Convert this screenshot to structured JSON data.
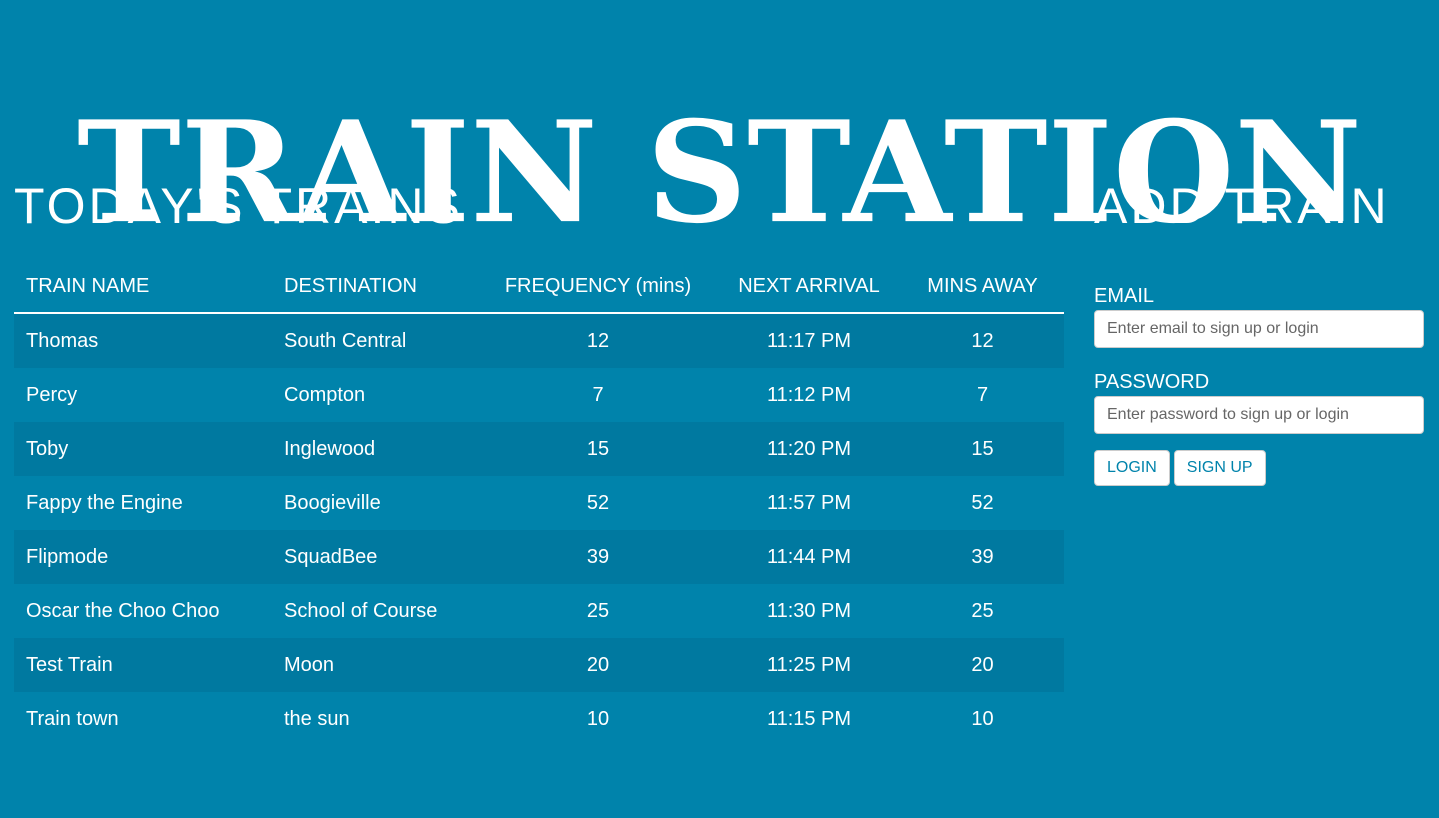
{
  "site": {
    "title": "TRAIN STATION"
  },
  "trains_section": {
    "title": "TODAY'S TRAINS",
    "columns": [
      "TRAIN NAME",
      "DESTINATION",
      "FREQUENCY (mins)",
      "NEXT ARRIVAL",
      "MINS AWAY"
    ],
    "rows": [
      {
        "name": "Thomas",
        "destination": "South Central",
        "frequency": "12",
        "next_arrival": "11:17 PM",
        "mins_away": "12"
      },
      {
        "name": "Percy",
        "destination": "Compton",
        "frequency": "7",
        "next_arrival": "11:12 PM",
        "mins_away": "7"
      },
      {
        "name": "Toby",
        "destination": "Inglewood",
        "frequency": "15",
        "next_arrival": "11:20 PM",
        "mins_away": "15"
      },
      {
        "name": "Fappy the Engine",
        "destination": "Boogieville",
        "frequency": "52",
        "next_arrival": "11:57 PM",
        "mins_away": "52"
      },
      {
        "name": "Flipmode",
        "destination": "SquadBee",
        "frequency": "39",
        "next_arrival": "11:44 PM",
        "mins_away": "39"
      },
      {
        "name": "Oscar the Choo Choo",
        "destination": "School of Course",
        "frequency": "25",
        "next_arrival": "11:30 PM",
        "mins_away": "25"
      },
      {
        "name": "Test Train",
        "destination": "Moon",
        "frequency": "20",
        "next_arrival": "11:25 PM",
        "mins_away": "20"
      },
      {
        "name": "Train town",
        "destination": "the sun",
        "frequency": "10",
        "next_arrival": "11:15 PM",
        "mins_away": "10"
      }
    ]
  },
  "add_section": {
    "title": "ADD TRAIN",
    "email": {
      "label": "EMAIL",
      "value": "",
      "placeholder": "Enter email to sign up or login"
    },
    "password": {
      "label": "PASSWORD",
      "value": "",
      "placeholder": "Enter password to sign up or login"
    },
    "login_label": "LOGIN",
    "signup_label": "SIGN UP"
  },
  "colors": {
    "background": "#0083ab",
    "row_stripe": "#0079a0",
    "text": "#ffffff",
    "button_text": "#0083ab"
  }
}
